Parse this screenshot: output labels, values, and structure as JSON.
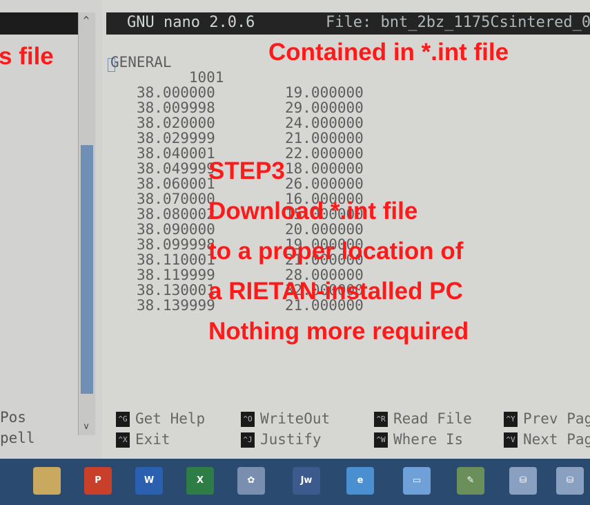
{
  "left_window": {
    "scroll_up": "^",
    "scroll_down": "v",
    "help_lines": [
      "Pos",
      "pell"
    ]
  },
  "nano": {
    "version": "GNU nano 2.0.6",
    "file": "File: bnt_2bz_1175Csintered_0",
    "lines": [
      {
        "a": "GENERAL",
        "b": ""
      },
      {
        "a": "      1001",
        "b": ""
      },
      {
        "a": "38.000000",
        "b": "19.000000"
      },
      {
        "a": "38.009998",
        "b": "29.000000"
      },
      {
        "a": "38.020000",
        "b": "24.000000"
      },
      {
        "a": "38.029999",
        "b": "21.000000"
      },
      {
        "a": "38.040001",
        "b": "22.000000"
      },
      {
        "a": "38.049999",
        "b": "18.000000"
      },
      {
        "a": "38.060001",
        "b": "26.000000"
      },
      {
        "a": "38.070000",
        "b": "16.000000"
      },
      {
        "a": "38.080002",
        "b": "15.000000"
      },
      {
        "a": "38.090000",
        "b": "20.000000"
      },
      {
        "a": "38.099998",
        "b": "19.000000"
      },
      {
        "a": "38.110001",
        "b": "21.000000"
      },
      {
        "a": "38.119999",
        "b": "28.000000"
      },
      {
        "a": "38.130001",
        "b": "32.000000"
      },
      {
        "a": "38.139999",
        "b": "21.000000"
      }
    ],
    "shortcuts": [
      {
        "key": "^G",
        "label": "Get Help"
      },
      {
        "key": "^O",
        "label": "WriteOut"
      },
      {
        "key": "^R",
        "label": "Read File"
      },
      {
        "key": "^Y",
        "label": "Prev Pag"
      },
      {
        "key": "^X",
        "label": "Exit"
      },
      {
        "key": "^J",
        "label": "Justify"
      },
      {
        "key": "^W",
        "label": "Where Is"
      },
      {
        "key": "^V",
        "label": "Next Pag"
      }
    ]
  },
  "taskbar": {
    "icons": [
      {
        "name": "file-explorer-icon",
        "color": "#c9a860",
        "glyph": ""
      },
      {
        "name": "powerpoint-icon",
        "color": "#c8402a",
        "glyph": "P"
      },
      {
        "name": "word-icon",
        "color": "#2b5fb0",
        "glyph": "W"
      },
      {
        "name": "excel-icon",
        "color": "#2e7d46",
        "glyph": "X"
      },
      {
        "name": "app-flower-icon",
        "color": "#7a8fb0",
        "glyph": "✿"
      },
      {
        "name": "plot-app-icon",
        "color": "#3c5a8c",
        "glyph": "Jw"
      },
      {
        "name": "internet-explorer-icon",
        "color": "#4a90d0",
        "glyph": "e"
      },
      {
        "name": "display-icon",
        "color": "#6fa0d8",
        "glyph": "▭"
      },
      {
        "name": "app-tool-icon",
        "color": "#6b8f5a",
        "glyph": "✎"
      },
      {
        "name": "network-icon",
        "color": "#8aa0c0",
        "glyph": "⛁"
      },
      {
        "name": "network-icon-2",
        "color": "#8aa0c0",
        "glyph": "⛁"
      }
    ]
  },
  "overlay": {
    "left_fragment": "s file",
    "contained": "Contained in *.int file",
    "step": "STEP3",
    "line1": "Download *.int file",
    "line2": "to a proper location of",
    "line3": "a RIETAN-installed PC",
    "line4": "Nothing more required",
    "color": "#ff1a1a"
  }
}
